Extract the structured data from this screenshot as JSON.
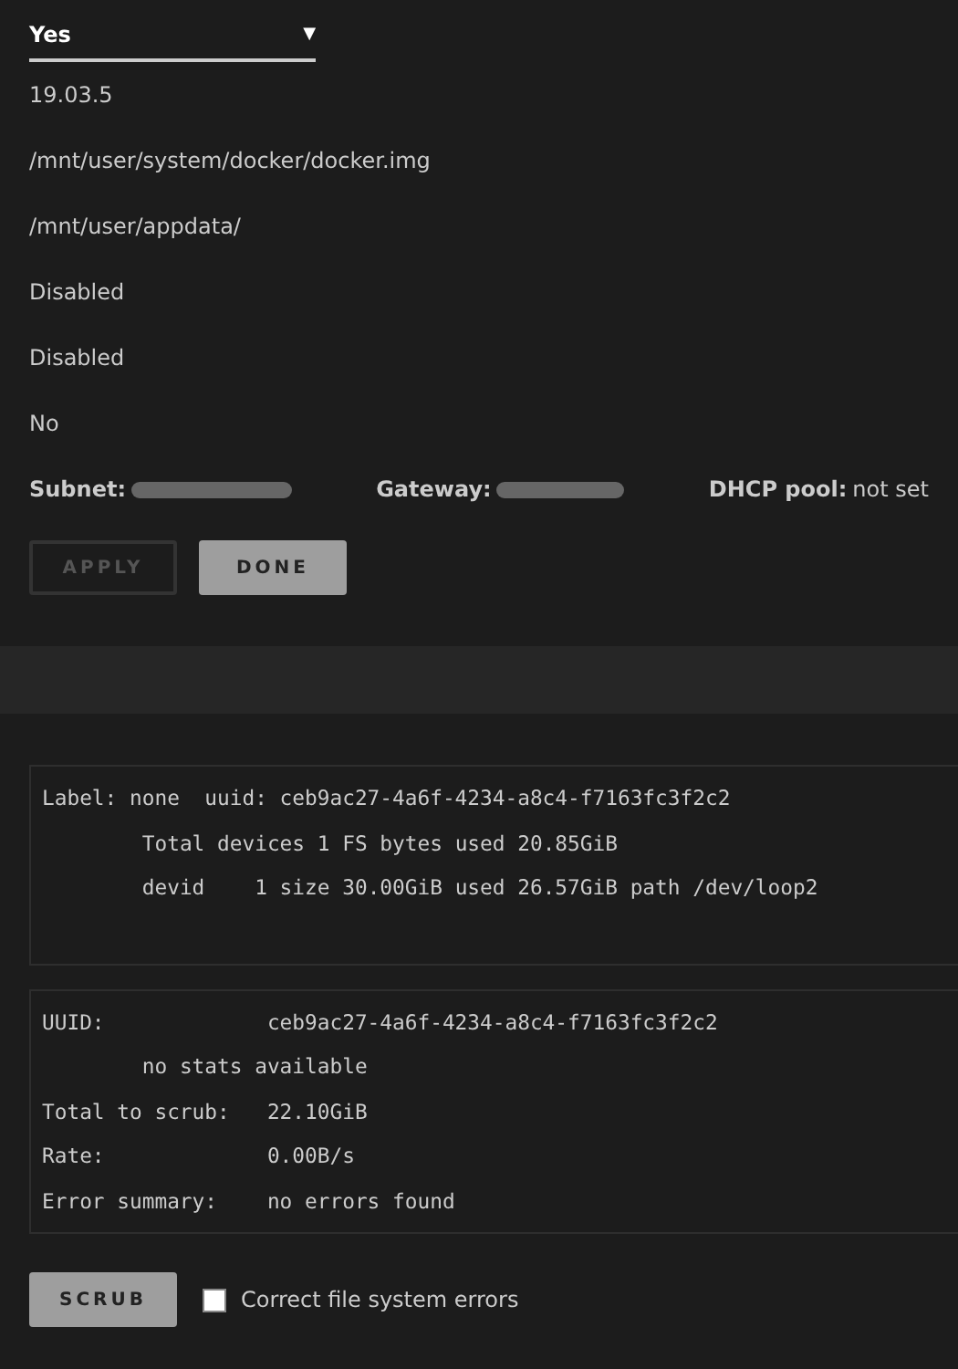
{
  "select": {
    "value": "Yes",
    "arrow": "▼"
  },
  "values": [
    "19.03.5",
    "/mnt/user/system/docker/docker.img",
    "/mnt/user/appdata/",
    "Disabled",
    "Disabled",
    "No"
  ],
  "network": [
    {
      "label": "Subnet:",
      "redacted": true
    },
    {
      "label": "Gateway:",
      "redacted": true
    },
    {
      "label": "DHCP pool:",
      "redacted": false,
      "value": "not set"
    }
  ],
  "buttons": [
    {
      "label": "APPLY",
      "disabled": true
    },
    {
      "label": "DONE",
      "disabled": false
    }
  ],
  "filesystem_output": [
    "Label: none  uuid: ceb9ac27-4a6f-4234-a8c4-f7163fc3f2c2",
    "\tTotal devices 1 FS bytes used 20.85GiB",
    "\tdevid    1 size 30.00GiB used 26.57GiB path /dev/loop2"
  ],
  "scrub_output": [
    "UUID:             ceb9ac27-4a6f-4234-a8c4-f7163fc3f2c2",
    "\tno stats available",
    "Total to scrub:   22.10GiB",
    "Rate:             0.00B/s",
    "Error summary:    no errors found"
  ],
  "scrub_button": {
    "label": "SCRUB",
    "disabled": false
  },
  "correct_errors": {
    "label": "Correct file system errors",
    "checked": false
  }
}
